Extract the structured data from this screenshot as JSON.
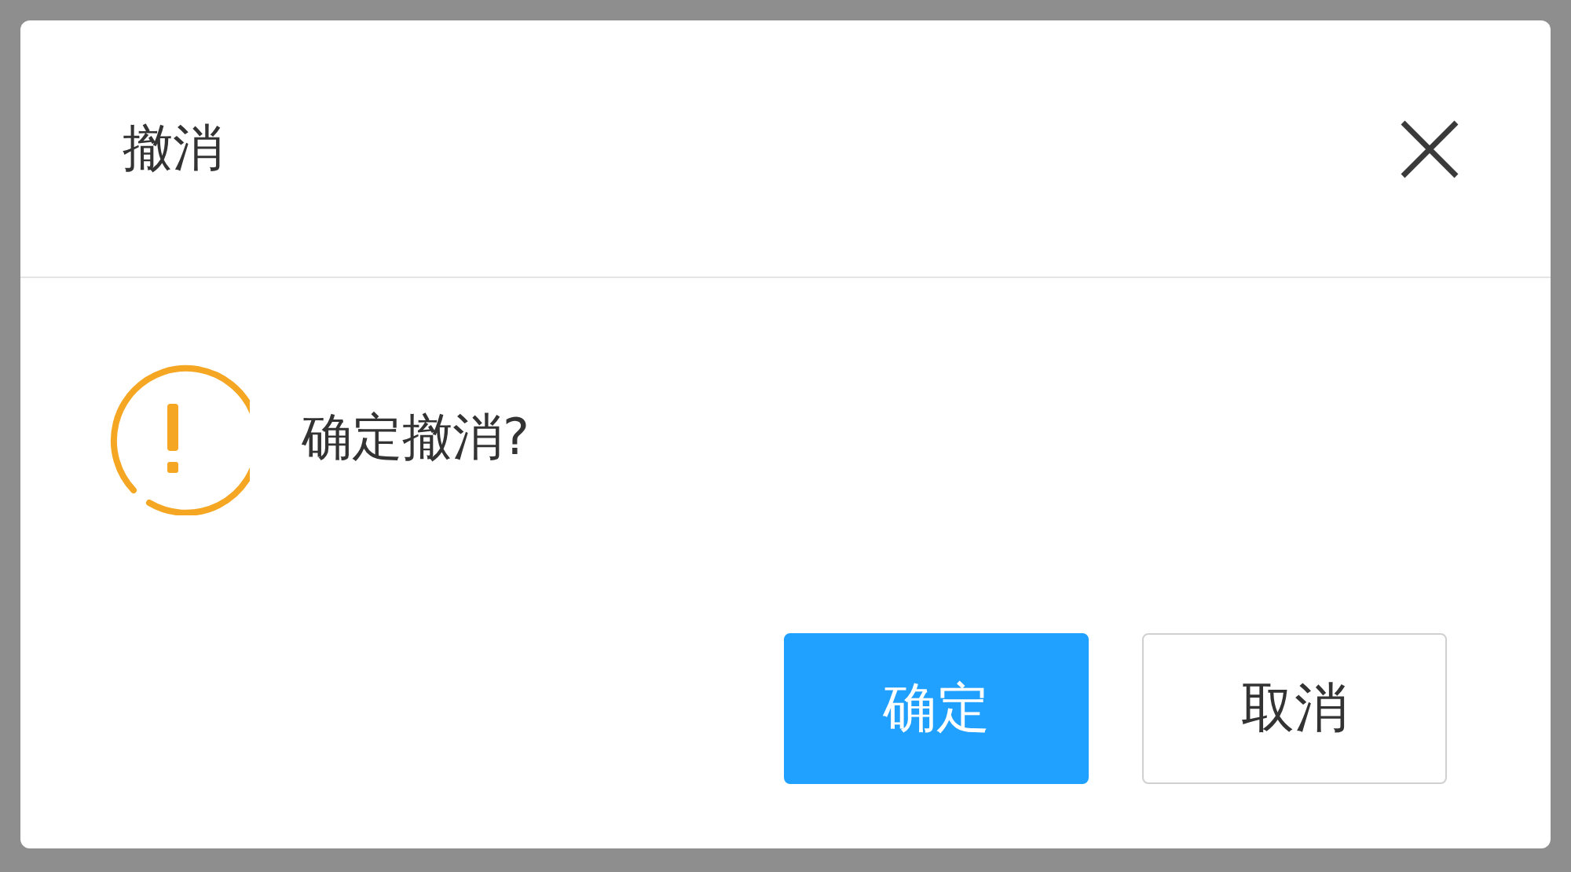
{
  "dialog": {
    "title": "撤消",
    "message": "确定撤消?",
    "buttons": [
      {
        "label": "确定",
        "kind": "primary"
      },
      {
        "label": "取消",
        "kind": "default"
      }
    ]
  }
}
